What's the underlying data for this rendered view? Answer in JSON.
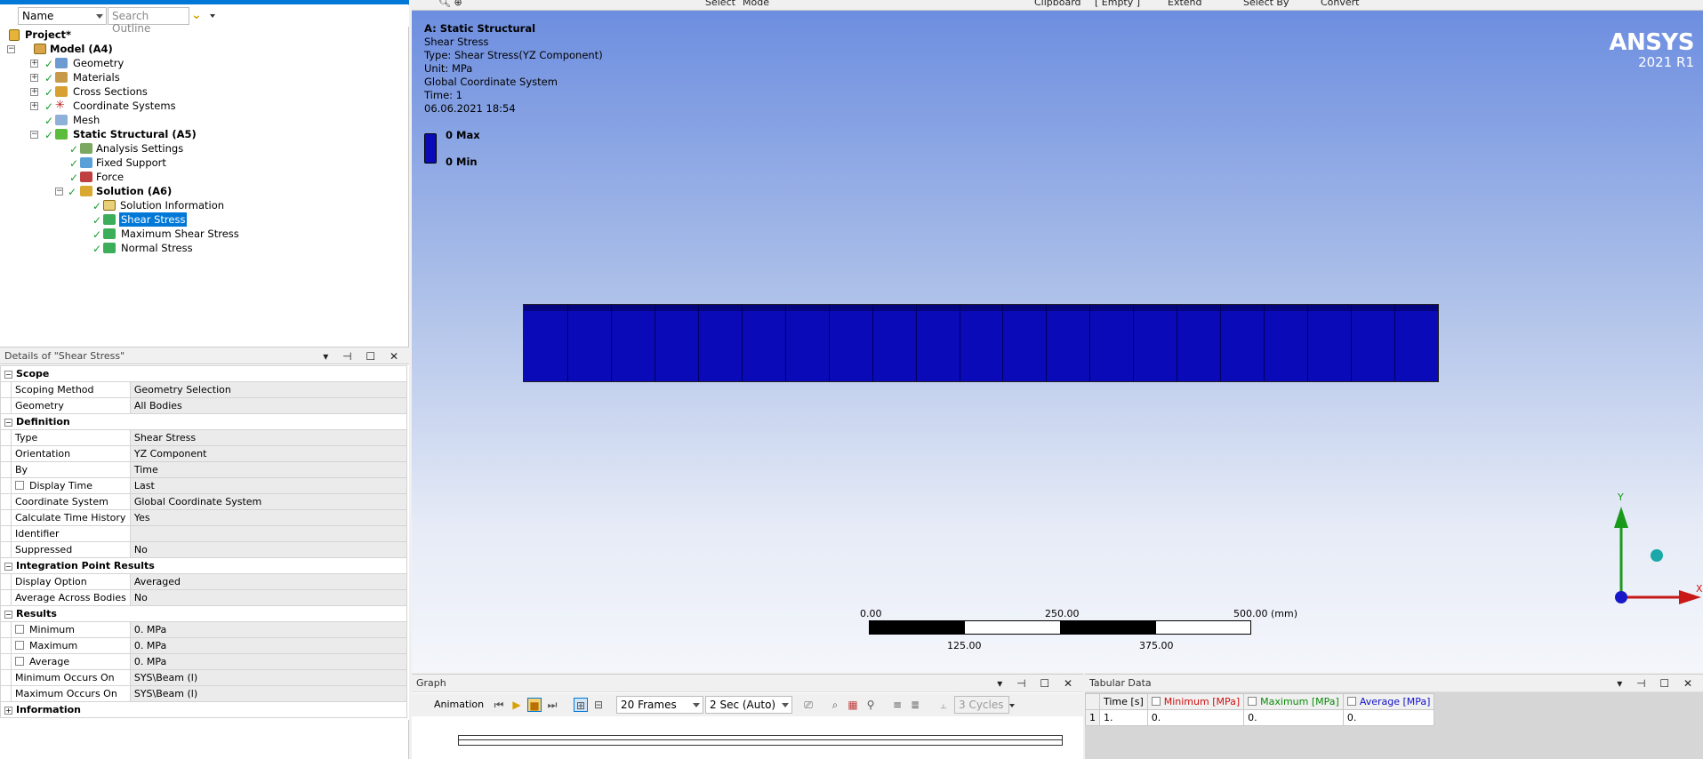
{
  "outline": {
    "filter_combo": "Name",
    "search_placeholder": "Search Outline",
    "tree": [
      {
        "label": "Project*",
        "bold": true
      },
      {
        "label": "Model (A4)",
        "bold": true
      },
      {
        "label": "Geometry"
      },
      {
        "label": "Materials"
      },
      {
        "label": "Cross Sections"
      },
      {
        "label": "Coordinate Systems"
      },
      {
        "label": "Mesh"
      },
      {
        "label": "Static Structural (A5)",
        "bold": true
      },
      {
        "label": "Analysis Settings"
      },
      {
        "label": "Fixed Support"
      },
      {
        "label": "Force"
      },
      {
        "label": "Solution (A6)",
        "bold": true
      },
      {
        "label": "Solution Information"
      },
      {
        "label": "Shear Stress",
        "selected": true
      },
      {
        "label": "Maximum Shear Stress"
      },
      {
        "label": "Normal Stress"
      }
    ]
  },
  "details": {
    "title": "Details of \"Shear Stress\"",
    "groups": [
      {
        "name": "Scope",
        "rows": [
          {
            "label": "Scoping Method",
            "value": "Geometry Selection"
          },
          {
            "label": "Geometry",
            "value": "All Bodies"
          }
        ]
      },
      {
        "name": "Definition",
        "rows": [
          {
            "label": "Type",
            "value": "Shear Stress"
          },
          {
            "label": "Orientation",
            "value": "YZ Component"
          },
          {
            "label": "By",
            "value": "Time"
          },
          {
            "label": "Display Time",
            "value": "Last",
            "checkbox": true
          },
          {
            "label": "Coordinate System",
            "value": "Global Coordinate System"
          },
          {
            "label": "Calculate Time History",
            "value": "Yes"
          },
          {
            "label": "Identifier",
            "value": ""
          },
          {
            "label": "Suppressed",
            "value": "No"
          }
        ]
      },
      {
        "name": "Integration Point Results",
        "rows": [
          {
            "label": "Display Option",
            "value": "Averaged"
          },
          {
            "label": "Average Across Bodies",
            "value": "No"
          }
        ]
      },
      {
        "name": "Results",
        "rows": [
          {
            "label": "Minimum",
            "value": "0. MPa",
            "checkbox": true
          },
          {
            "label": "Maximum",
            "value": "0. MPa",
            "checkbox": true
          },
          {
            "label": "Average",
            "value": "0. MPa",
            "checkbox": true
          },
          {
            "label": "Minimum Occurs On",
            "value": "SYS\\Beam (l)"
          },
          {
            "label": "Maximum Occurs On",
            "value": "SYS\\Beam (l)"
          }
        ]
      },
      {
        "name": "Information",
        "collapsed": true,
        "rows": []
      }
    ]
  },
  "toolbar": {
    "select": "Select",
    "mode": "Mode",
    "clipboard": "Clipboard",
    "empty": "[ Empty ]",
    "extend": "Extend",
    "select_by": "Select By",
    "convert": "Convert"
  },
  "viewport": {
    "header": {
      "title": "A: Static Structural",
      "result": "Shear Stress",
      "type": "Type: Shear Stress(YZ Component)",
      "unit": "Unit: MPa",
      "coord": "Global Coordinate System",
      "time": "Time: 1",
      "date": "06.06.2021 18:54"
    },
    "legend": {
      "max": "0 Max",
      "min": "0 Min",
      "color": "#0a0ab8"
    },
    "brand": {
      "name": "ANSYS",
      "version": "2021 R1"
    },
    "scale_bar": {
      "top_labels": [
        "0.00",
        "250.00",
        "500.00 (mm)"
      ],
      "bottom_labels": [
        "125.00",
        "375.00"
      ]
    },
    "triad": {
      "y": "Y",
      "x": "X"
    }
  },
  "graph": {
    "title": "Graph",
    "animation_label": "Animation",
    "frames": "20 Frames",
    "duration": "2 Sec (Auto)",
    "cycles": "3 Cycles"
  },
  "tabular": {
    "title": "Tabular Data",
    "columns": [
      "Time [s]",
      "Minimum [MPa]",
      "Maximum [MPa]",
      "Average [MPa]"
    ],
    "column_colors": [
      "#000000",
      "#d01010",
      "#0a8a0a",
      "#1010c8"
    ],
    "rows": [
      [
        "1",
        "1.",
        "0.",
        "0.",
        "0."
      ]
    ]
  }
}
